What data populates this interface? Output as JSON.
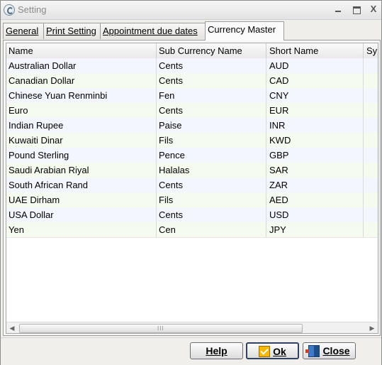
{
  "window": {
    "title": "Setting",
    "controls": [
      "minimize-icon",
      "maximize-icon",
      "close-icon"
    ]
  },
  "tabs": [
    {
      "label": "General",
      "active": false
    },
    {
      "label": "Print Setting",
      "active": false
    },
    {
      "label": "Appointment due dates",
      "active": false
    },
    {
      "label": "Currency Master",
      "active": true
    }
  ],
  "table": {
    "columns": [
      "Name",
      "Sub Currency Name",
      "Short Name",
      "Sy"
    ],
    "rows": [
      {
        "name": "Australian Dollar",
        "sub_currency_name": "Cents",
        "short_name": "AUD"
      },
      {
        "name": "Canadian Dollar",
        "sub_currency_name": "Cents",
        "short_name": "CAD"
      },
      {
        "name": "Chinese Yuan Renminbi",
        "sub_currency_name": "Fen",
        "short_name": "CNY"
      },
      {
        "name": "Euro",
        "sub_currency_name": "Cents",
        "short_name": "EUR"
      },
      {
        "name": "Indian Rupee",
        "sub_currency_name": "Paise",
        "short_name": "INR"
      },
      {
        "name": "Kuwaiti Dinar",
        "sub_currency_name": "Fils",
        "short_name": "KWD"
      },
      {
        "name": "Pound Sterling",
        "sub_currency_name": "Pence",
        "short_name": "GBP"
      },
      {
        "name": "Saudi Arabian Riyal",
        "sub_currency_name": "Halalas",
        "short_name": "SAR"
      },
      {
        "name": "South African Rand",
        "sub_currency_name": "Cents",
        "short_name": "ZAR"
      },
      {
        "name": "UAE Dirham",
        "sub_currency_name": "Fils",
        "short_name": "AED"
      },
      {
        "name": "USA Dollar",
        "sub_currency_name": "Cents",
        "short_name": "USD"
      },
      {
        "name": "Yen",
        "sub_currency_name": "Cen",
        "short_name": "JPY"
      }
    ]
  },
  "scrollbar": {
    "grip": "III"
  },
  "buttons": {
    "help": "Help",
    "ok": "Ok",
    "close": "Close"
  }
}
